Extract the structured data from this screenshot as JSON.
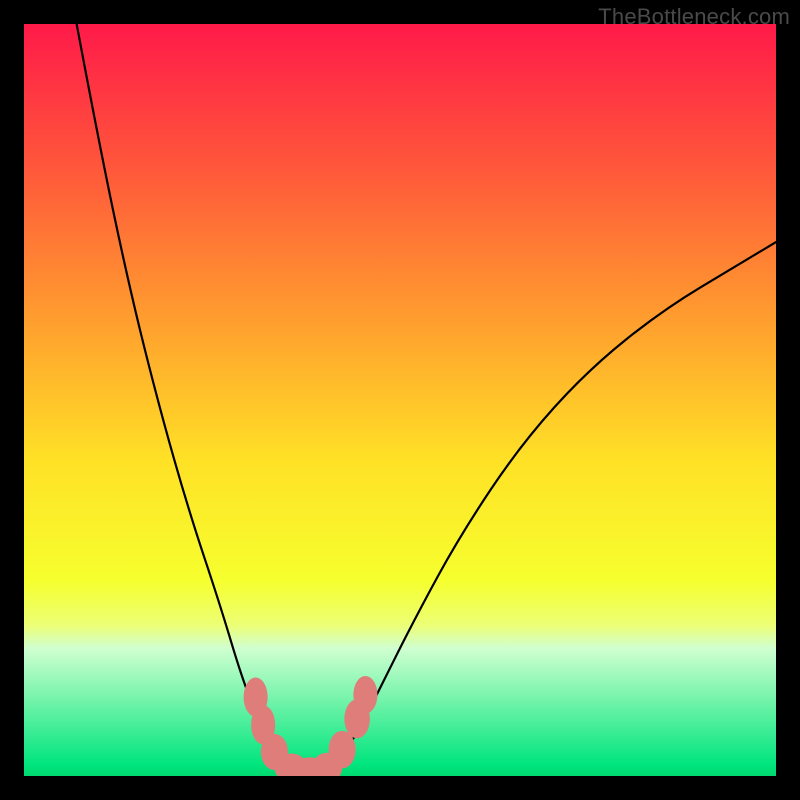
{
  "watermark": "TheBottleneck.com",
  "chart_data": {
    "type": "line",
    "title": "",
    "xlabel": "",
    "ylabel": "",
    "xlim": [
      0,
      100
    ],
    "ylim": [
      0,
      100
    ],
    "background_gradient": {
      "type": "rainbow_vertical",
      "stops": [
        {
          "offset": 0.0,
          "color": "#ff1a49"
        },
        {
          "offset": 0.2,
          "color": "#ff5a3a"
        },
        {
          "offset": 0.4,
          "color": "#ffa02e"
        },
        {
          "offset": 0.58,
          "color": "#ffe126"
        },
        {
          "offset": 0.74,
          "color": "#f6ff2e"
        },
        {
          "offset": 0.8,
          "color": "#ecff76"
        },
        {
          "offset": 0.83,
          "color": "#d0ffd0"
        },
        {
          "offset": 0.985,
          "color": "#00e57d"
        },
        {
          "offset": 1.0,
          "color": "#00d86f"
        }
      ]
    },
    "series": [
      {
        "name": "bottleneck-curve",
        "stroke": "#000000",
        "stroke_width": 2.2,
        "points": [
          {
            "x": 7,
            "y": 100
          },
          {
            "x": 10,
            "y": 84
          },
          {
            "x": 14,
            "y": 65
          },
          {
            "x": 18,
            "y": 49
          },
          {
            "x": 22,
            "y": 35
          },
          {
            "x": 26,
            "y": 23
          },
          {
            "x": 29,
            "y": 13
          },
          {
            "x": 31,
            "y": 8
          },
          {
            "x": 33,
            "y": 4
          },
          {
            "x": 35,
            "y": 1.5
          },
          {
            "x": 37,
            "y": 0.5
          },
          {
            "x": 39,
            "y": 0.5
          },
          {
            "x": 41,
            "y": 1.5
          },
          {
            "x": 44,
            "y": 5
          },
          {
            "x": 47,
            "y": 11
          },
          {
            "x": 52,
            "y": 21
          },
          {
            "x": 58,
            "y": 32
          },
          {
            "x": 66,
            "y": 44
          },
          {
            "x": 75,
            "y": 54
          },
          {
            "x": 85,
            "y": 62
          },
          {
            "x": 95,
            "y": 68
          },
          {
            "x": 100,
            "y": 71
          }
        ]
      }
    ],
    "markers": [
      {
        "name": "gap-marker",
        "cx": 30.8,
        "cy": 10.5,
        "rx": 1.6,
        "ry": 2.6,
        "fill": "#df7d7a"
      },
      {
        "name": "gap-marker",
        "cx": 31.8,
        "cy": 6.8,
        "rx": 1.6,
        "ry": 2.6,
        "fill": "#df7d7a"
      },
      {
        "name": "gap-marker",
        "cx": 33.3,
        "cy": 3.2,
        "rx": 1.8,
        "ry": 2.4,
        "fill": "#df7d7a"
      },
      {
        "name": "gap-marker",
        "cx": 35.5,
        "cy": 1.1,
        "rx": 2.2,
        "ry": 1.9,
        "fill": "#df7d7a"
      },
      {
        "name": "gap-marker",
        "cx": 38.0,
        "cy": 0.6,
        "rx": 2.2,
        "ry": 1.9,
        "fill": "#df7d7a"
      },
      {
        "name": "gap-marker",
        "cx": 40.3,
        "cy": 1.1,
        "rx": 2.0,
        "ry": 2.0,
        "fill": "#df7d7a"
      },
      {
        "name": "gap-marker",
        "cx": 42.3,
        "cy": 3.5,
        "rx": 1.8,
        "ry": 2.5,
        "fill": "#df7d7a"
      },
      {
        "name": "gap-marker",
        "cx": 44.3,
        "cy": 7.6,
        "rx": 1.7,
        "ry": 2.6,
        "fill": "#df7d7a"
      },
      {
        "name": "gap-marker",
        "cx": 45.4,
        "cy": 10.8,
        "rx": 1.6,
        "ry": 2.5,
        "fill": "#df7d7a"
      }
    ]
  }
}
